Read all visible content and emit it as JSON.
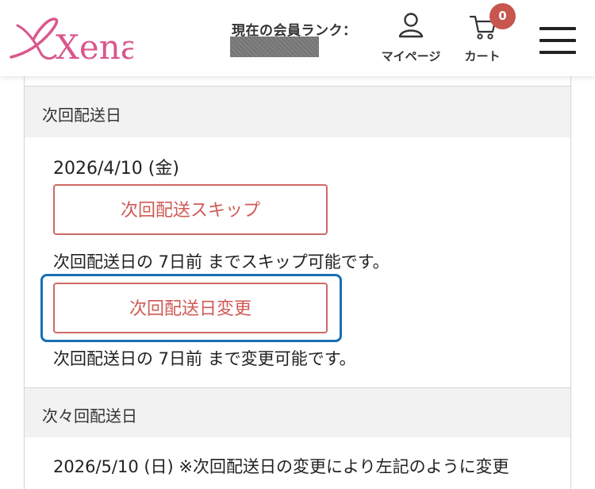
{
  "header": {
    "logo_text": "Xena",
    "rank_label": "現在の会員ランク：",
    "mypage_label": "マイページ",
    "cart_label": "カート",
    "cart_count": "0"
  },
  "colors": {
    "brand_pink": "#d9578d",
    "button_red": "#cf5a55",
    "badge_red": "#c6564e",
    "focus_blue": "#1a6fb3"
  },
  "next_delivery": {
    "heading": "次回配送日",
    "date": "2026/4/10 (金)",
    "skip_button": "次回配送スキップ",
    "skip_note": "次回配送日の 7日前 までスキップ可能です。",
    "change_button": "次回配送日変更",
    "change_note": "次回配送日の 7日前 まで変更可能です。"
  },
  "following_delivery": {
    "heading": "次々回配送日",
    "date_text": "2026/5/10 (日) ※次回配送日の変更により左記のように変更"
  }
}
